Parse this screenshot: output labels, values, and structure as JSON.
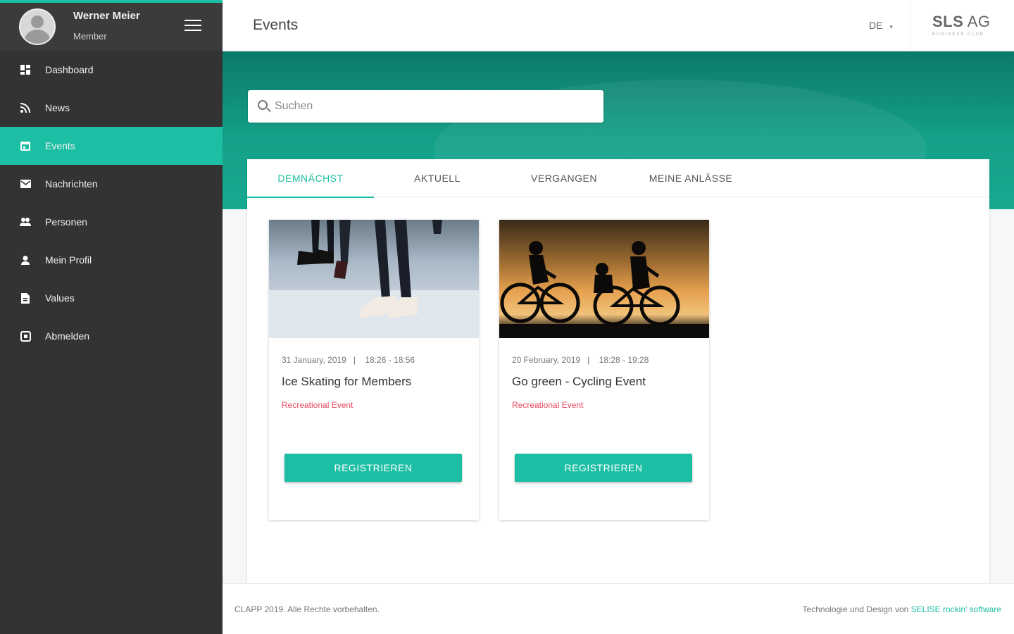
{
  "user": {
    "name": "Werner Meier",
    "role": "Member"
  },
  "nav": [
    {
      "label": "Dashboard",
      "icon": "dashboard-icon"
    },
    {
      "label": "News",
      "icon": "rss-icon"
    },
    {
      "label": "Events",
      "icon": "calendar-icon",
      "active": true
    },
    {
      "label": "Nachrichten",
      "icon": "mail-icon"
    },
    {
      "label": "Personen",
      "icon": "people-icon"
    },
    {
      "label": "Mein Profil",
      "icon": "person-icon"
    },
    {
      "label": "Values",
      "icon": "document-icon"
    },
    {
      "label": "Abmelden",
      "icon": "logout-icon"
    }
  ],
  "header": {
    "title": "Events",
    "language": "DE",
    "brand": {
      "bold": "SLS",
      "light": " AG",
      "sub": "BUSINESS CLUB"
    }
  },
  "search": {
    "placeholder": "Suchen"
  },
  "tabs": [
    {
      "label": "DEMNÄCHST",
      "active": true
    },
    {
      "label": "AKTUELL"
    },
    {
      "label": "VERGANGEN"
    },
    {
      "label": "MEINE ANLÄSSE"
    }
  ],
  "events": [
    {
      "date": "31 January, 2019",
      "time": "18:26 - 18:56",
      "title": "Ice Skating for Members",
      "category": "Recreational Event",
      "button": "REGISTRIEREN"
    },
    {
      "date": "20 February, 2019",
      "time": "18:28 - 19:28",
      "title": "Go green - Cycling Event",
      "category": "Recreational Event",
      "button": "REGISTRIEREN"
    }
  ],
  "footer": {
    "copyright": "CLAPP 2019. Alle Rechte vorbehalten.",
    "credit_prefix": "Technologie und Design von ",
    "credit_link": "SELISE rockin' software"
  },
  "colors": {
    "accent": "#1cbfa3",
    "sidebar": "#333333",
    "category": "#e84a5f"
  }
}
